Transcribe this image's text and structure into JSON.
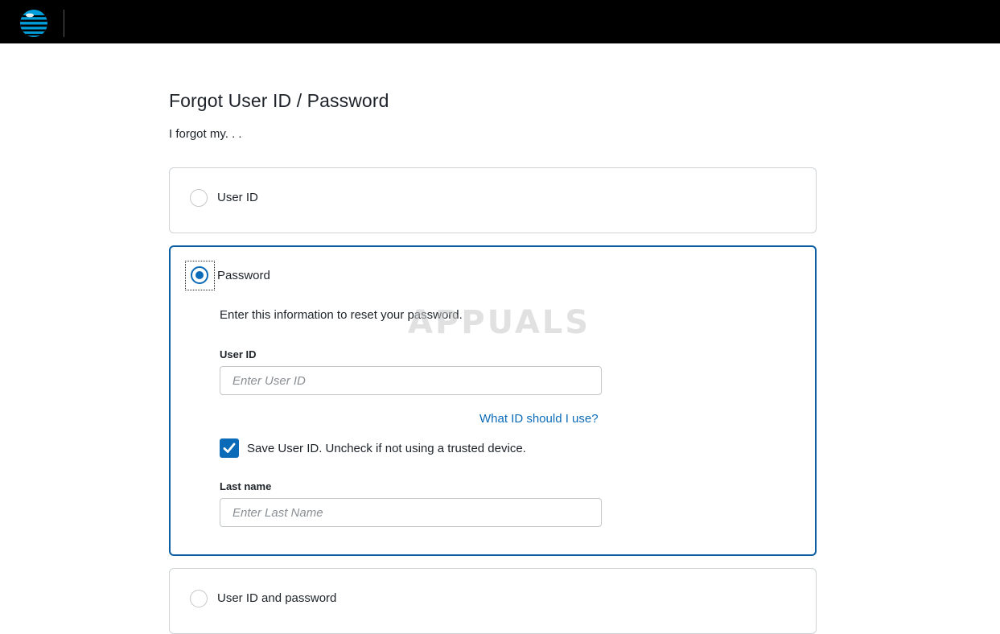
{
  "header": {
    "logo_icon": "att-globe-icon",
    "brand_color": "#0b6bb8"
  },
  "page": {
    "title": "Forgot User ID / Password",
    "prompt": "I forgot my. . ."
  },
  "options": {
    "user_id": {
      "label": "User ID",
      "selected": false
    },
    "password": {
      "label": "Password",
      "selected": true,
      "info": "Enter this information to reset your password.",
      "user_id_label": "User ID",
      "user_id_placeholder": "Enter User ID",
      "user_id_value": "",
      "help_link": "What ID should I use?",
      "save_checkbox_label": "Save User ID. Uncheck if not using a trusted device.",
      "save_checked": true,
      "last_name_label": "Last name",
      "last_name_placeholder": "Enter Last Name",
      "last_name_value": ""
    },
    "user_id_and_password": {
      "label": "User ID and password",
      "selected": false
    }
  },
  "watermark": {
    "text": "APPUALS"
  }
}
